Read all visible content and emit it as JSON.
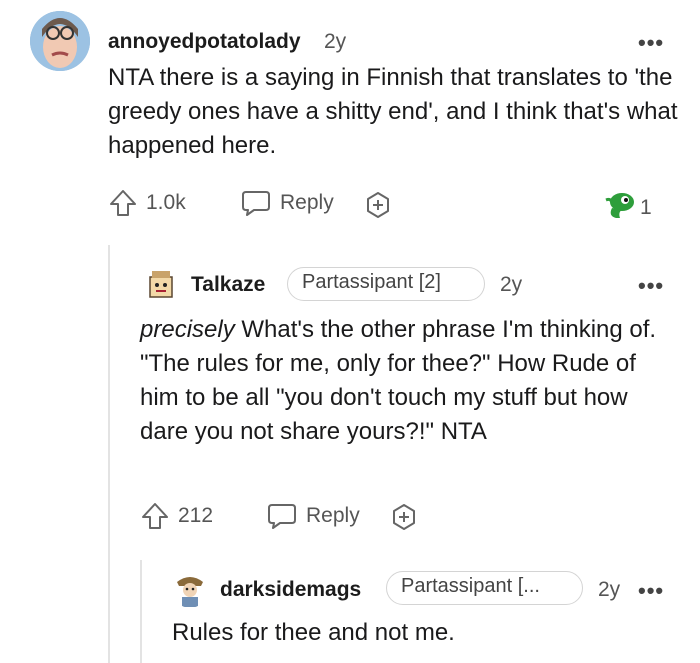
{
  "comments": [
    {
      "username": "annoyedpotatolady",
      "age": "2y",
      "body": "NTA there is a saying in Finnish that translates to 'the greedy ones have a shitty end', and I think that's what happened here.",
      "upvotes": "1.0k",
      "reply_label": "Reply",
      "award_count": "1"
    },
    {
      "username": "Talkaze",
      "flair": "Partassipant [2]",
      "age": "2y",
      "body_italic": "precisely",
      "body": " What's the other phrase I'm thinking of. \"The rules for me, only for thee?\" How Rude of him to be all \"you don't touch my stuff but how dare you not share yours?!\" NTA",
      "upvotes": "212",
      "reply_label": "Reply"
    },
    {
      "username": "darksidemags",
      "flair": "Partassipant [...",
      "age": "2y",
      "body": "Rules for thee and not me."
    }
  ],
  "more_label": "•••",
  "icons": [
    "upvote-icon",
    "reply-icon",
    "award-icon",
    "snoo-award-icon",
    "more-options-icon"
  ]
}
